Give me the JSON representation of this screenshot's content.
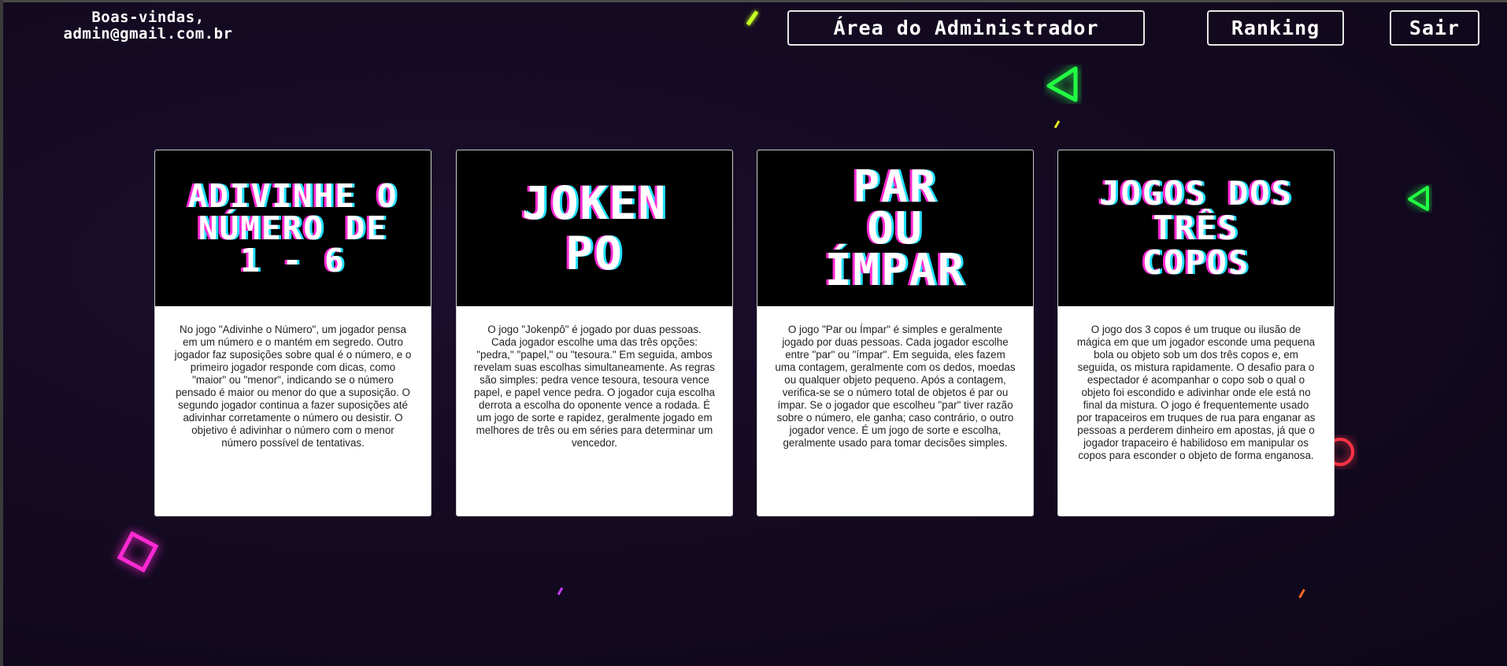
{
  "header": {
    "welcome_line1": "Boas-vindas,",
    "welcome_line2": "admin@gmail.com.br",
    "admin_label": "Área do Administrador",
    "ranking_label": "Ranking",
    "logout_label": "Sair"
  },
  "cards": [
    {
      "title_lines": [
        "ADIVINHE O",
        "NÚMERO DE",
        "1 - 6"
      ],
      "description": "No jogo \"Adivinhe o Número\", um jogador pensa em um número e o mantém em segredo. Outro jogador faz suposições sobre qual é o número, e o primeiro jogador responde com dicas, como \"maior\" ou \"menor\", indicando se o número pensado é maior ou menor do que a suposição. O segundo jogador continua a fazer suposições até adivinhar corretamente o número ou desistir. O objetivo é adivinhar o número com o menor número possível de tentativas."
    },
    {
      "title_lines": [
        "JOKEN",
        "PO"
      ],
      "description": "O jogo \"Jokenpô\" é jogado por duas pessoas. Cada jogador escolhe uma das três opções: \"pedra,\" \"papel,\" ou \"tesoura.\" Em seguida, ambos revelam suas escolhas simultaneamente. As regras são simples: pedra vence tesoura, tesoura vence papel, e papel vence pedra. O jogador cuja escolha derrota a escolha do oponente vence a rodada. É um jogo de sorte e rapidez, geralmente jogado em melhores de três ou em séries para determinar um vencedor."
    },
    {
      "title_lines": [
        "PAR",
        "OU",
        "ÍMPAR"
      ],
      "description": "O jogo \"Par ou Ímpar\" é simples e geralmente jogado por duas pessoas. Cada jogador escolhe entre \"par\" ou \"ímpar\". Em seguida, eles fazem uma contagem, geralmente com os dedos, moedas ou qualquer objeto pequeno. Após a contagem, verifica-se se o número total de objetos é par ou ímpar. Se o jogador que escolheu \"par\" tiver razão sobre o número, ele ganha; caso contrário, o outro jogador vence. É um jogo de sorte e escolha, geralmente usado para tomar decisões simples."
    },
    {
      "title_lines": [
        "JOGOS DOS",
        "TRÊS",
        "COPOS"
      ],
      "description": "O jogo dos 3 copos é um truque ou ilusão de mágica em que um jogador esconde uma pequena bola ou objeto sob um dos três copos e, em seguida, os mistura rapidamente. O desafio para o espectador é acompanhar o copo sob o qual o objeto foi escondido e adivinhar onde ele está no final da mistura. O jogo é frequentemente usado por trapaceiros em truques de rua para enganar as pessoas a perderem dinheiro em apostas, já que o jogador trapaceiro é habilidoso em manipular os copos para esconder o objeto de forma enganosa."
    }
  ],
  "colors": {
    "title_shadow_pink": "#ff2ad4",
    "title_shadow_cyan": "#22e0ff",
    "neon_green": "#22ff44",
    "neon_pink": "#ff2ad4",
    "neon_red": "#ff3344"
  },
  "decor": {
    "icons": [
      "neon-triangle-icon",
      "neon-triangle-icon",
      "neon-square-icon",
      "neon-circle-icon"
    ]
  }
}
